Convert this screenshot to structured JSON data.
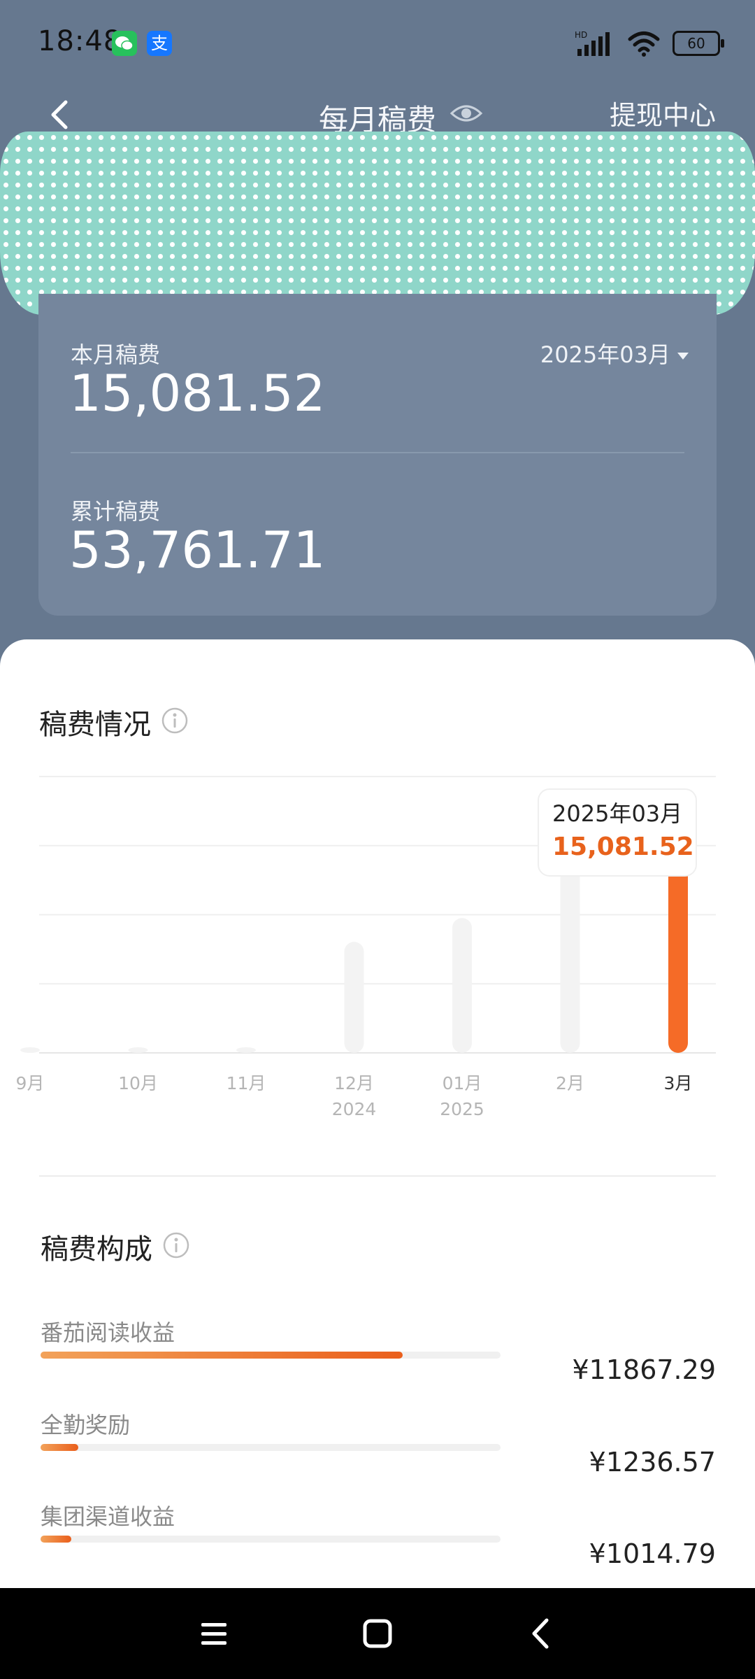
{
  "status_bar": {
    "time": "18:48",
    "battery": "60",
    "wechat_badge": "",
    "alipay_badge": "支"
  },
  "header": {
    "title": "每月稿费",
    "withdraw_link": "提现中心"
  },
  "summary": {
    "month_label": "本月稿费",
    "month_value": "15,081.52",
    "date_selector": "2025年03月",
    "total_label": "累计稿费",
    "total_value": "53,761.71"
  },
  "earnings_section": {
    "title": "稿费情况"
  },
  "chart_data": {
    "type": "bar",
    "categories": [
      "9月",
      "10月",
      "11月",
      "12月",
      "01月",
      "2月",
      "3月"
    ],
    "sublabels": [
      "",
      "",
      "",
      "2024",
      "2025",
      "",
      ""
    ],
    "values": [
      50,
      100,
      80,
      8400,
      10200,
      18500,
      15081.52
    ],
    "selected_index": 6,
    "tooltip": {
      "date": "2025年03月",
      "value": "15,081.52"
    },
    "colors": {
      "active": "#f56b27",
      "inactive": "#f3f3f3"
    }
  },
  "composition_section": {
    "title": "稿费构成",
    "items": [
      {
        "label": "番茄阅读收益",
        "amount": "¥11867.29",
        "ratio": 0.787
      },
      {
        "label": "全勤奖励",
        "amount": "¥1236.57",
        "ratio": 0.082
      },
      {
        "label": "集团渠道收益",
        "amount": "¥1014.79",
        "ratio": 0.067
      }
    ]
  },
  "colors": {
    "accent": "#ea5f1c",
    "header_bg": "#66788f",
    "card_bg": "#75869d"
  }
}
